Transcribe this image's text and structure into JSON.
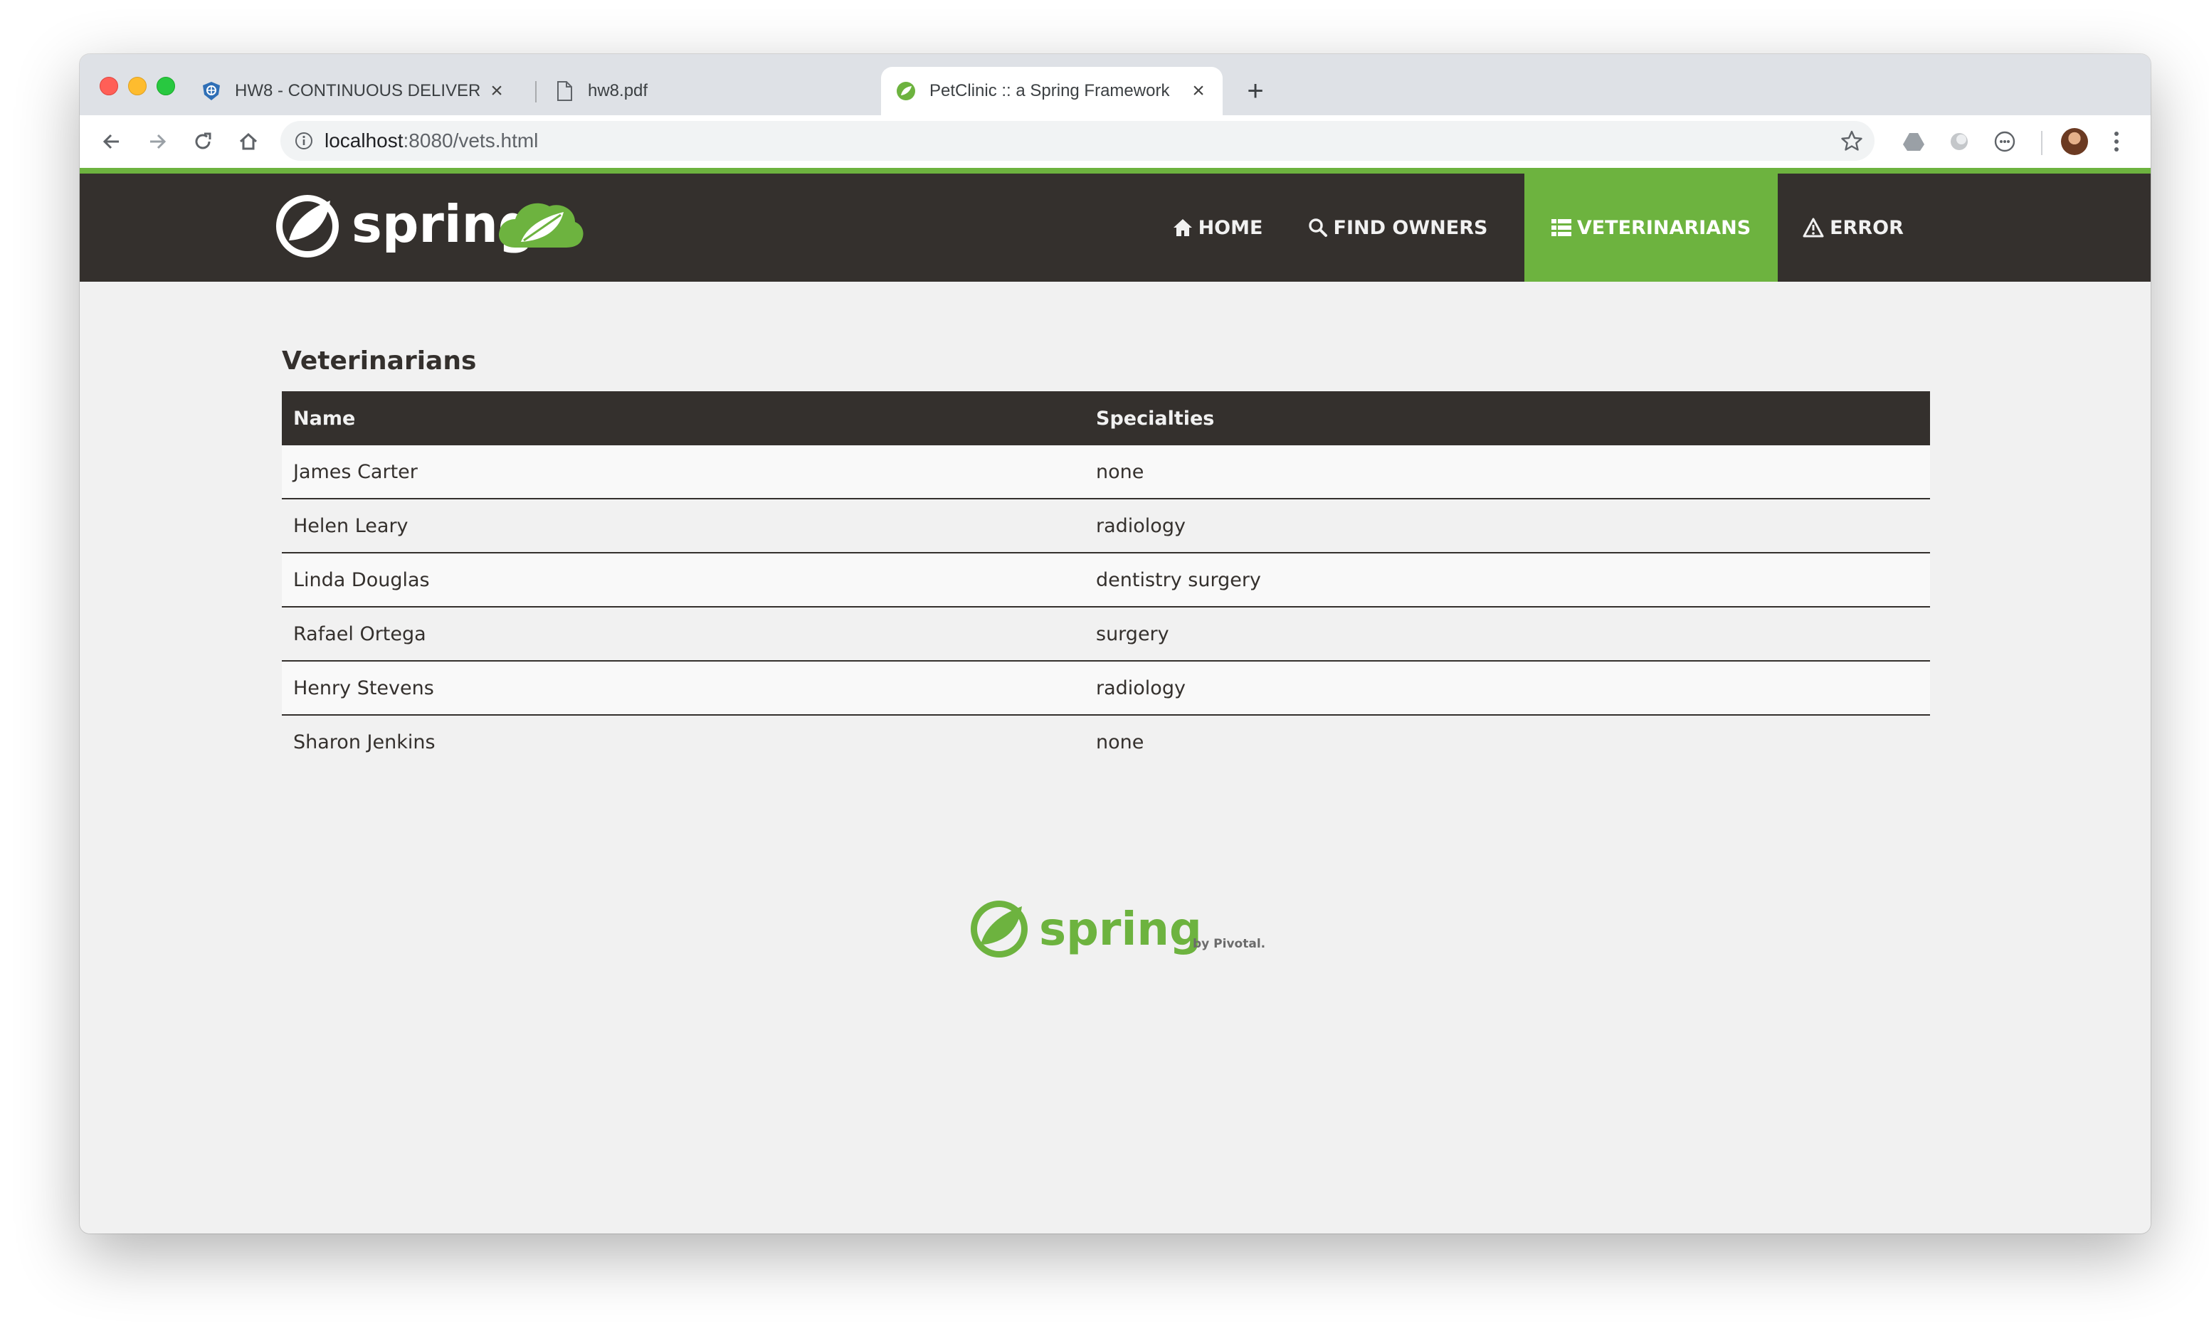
{
  "browser": {
    "tabs": [
      {
        "title": "HW8 - CONTINUOUS DELIVER",
        "favicon": "jira-shield-icon",
        "active": false
      },
      {
        "title": "hw8.pdf",
        "favicon": "document-icon",
        "active": false
      },
      {
        "title": "PetClinic :: a Spring Framework",
        "favicon": "spring-leaf-icon",
        "active": true
      }
    ],
    "new_tab": "+",
    "close_glyph": "×",
    "url": {
      "host": "localhost",
      "rest": ":8080/vets.html"
    }
  },
  "navbar": {
    "brand_text": "spring",
    "items": [
      {
        "label": "HOME",
        "icon": "home-icon",
        "active": false
      },
      {
        "label": "FIND OWNERS",
        "icon": "search-icon",
        "active": false
      },
      {
        "label": "VETERINARIANS",
        "icon": "list-icon",
        "active": true
      },
      {
        "label": "ERROR",
        "icon": "warning-icon",
        "active": false
      }
    ]
  },
  "vets": {
    "heading": "Veterinarians",
    "columns": [
      "Name",
      "Specialties"
    ],
    "rows": [
      {
        "name": "James Carter",
        "specialties": "none"
      },
      {
        "name": "Helen Leary",
        "specialties": "radiology"
      },
      {
        "name": "Linda Douglas",
        "specialties": "dentistry surgery"
      },
      {
        "name": "Rafael Ortega",
        "specialties": "surgery"
      },
      {
        "name": "Henry Stevens",
        "specialties": "radiology"
      },
      {
        "name": "Sharon Jenkins",
        "specialties": "none"
      }
    ]
  },
  "footer": {
    "brand_text": "spring",
    "by_text": "by Pivotal."
  },
  "colors": {
    "spring_green": "#6db33f",
    "spring_dark": "#34302d",
    "page_bg": "#f1f1f1"
  }
}
